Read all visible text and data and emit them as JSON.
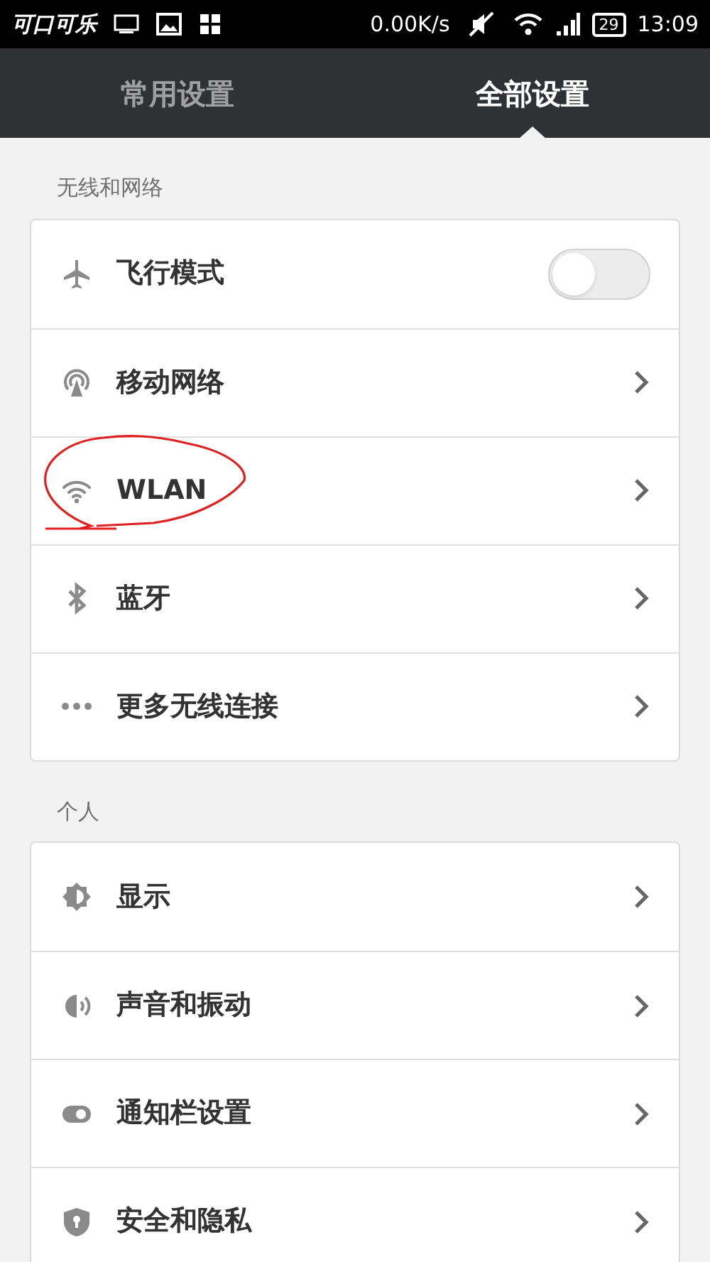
{
  "status_bar": {
    "logo_text": "可口可乐",
    "speed": "0.00K/s",
    "battery": "29",
    "time": "13:09"
  },
  "tabs": [
    {
      "label": "常用设置",
      "selected": false
    },
    {
      "label": "全部设置",
      "selected": true
    }
  ],
  "sections": [
    {
      "title": "无线和网络",
      "items": [
        {
          "label": "飞行模式",
          "kind": "toggle",
          "on": false,
          "annotated": false
        },
        {
          "label": "移动网络",
          "kind": "link",
          "annotated": false
        },
        {
          "label": "WLAN",
          "kind": "link",
          "annotated": true
        },
        {
          "label": "蓝牙",
          "kind": "link",
          "annotated": false
        },
        {
          "label": "更多无线连接",
          "kind": "link",
          "annotated": false
        }
      ]
    },
    {
      "title": "个人",
      "items": [
        {
          "label": "显示",
          "kind": "link",
          "annotated": false
        },
        {
          "label": "声音和振动",
          "kind": "link",
          "annotated": false
        },
        {
          "label": "通知栏设置",
          "kind": "link",
          "annotated": false
        },
        {
          "label": "安全和隐私",
          "kind": "link",
          "annotated": false
        }
      ]
    }
  ]
}
